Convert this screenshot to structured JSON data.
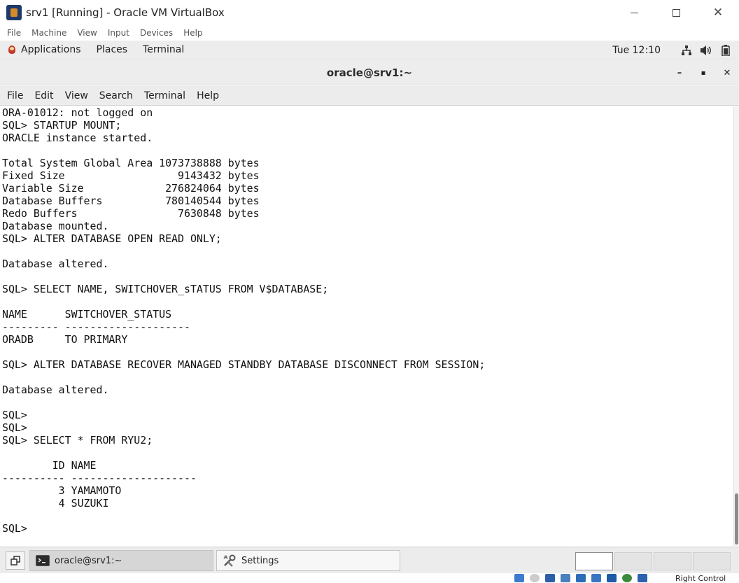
{
  "host": {
    "title": "srv1 [Running] - Oracle VM VirtualBox",
    "controls": {
      "minimize": "",
      "maximize": "",
      "close": "✕"
    }
  },
  "vbox_menu": [
    "File",
    "Machine",
    "View",
    "Input",
    "Devices",
    "Help"
  ],
  "guest_panel": {
    "items": [
      "Applications",
      "Places",
      "Terminal"
    ],
    "clock": "Tue 12:10"
  },
  "terminal": {
    "title": "oracle@srv1:~",
    "controls": {
      "minimize": "–",
      "maximize": "▪",
      "close": "✕"
    },
    "menu": [
      "File",
      "Edit",
      "View",
      "Search",
      "Terminal",
      "Help"
    ],
    "lines": [
      "ORA-01012: not logged on",
      "SQL> STARTUP MOUNT;",
      "ORACLE instance started.",
      "",
      "Total System Global Area 1073738888 bytes",
      "Fixed Size                  9143432 bytes",
      "Variable Size             276824064 bytes",
      "Database Buffers          780140544 bytes",
      "Redo Buffers                7630848 bytes",
      "Database mounted.",
      "SQL> ALTER DATABASE OPEN READ ONLY;",
      "",
      "Database altered.",
      "",
      "SQL> SELECT NAME, SWITCHOVER_sTATUS FROM V$DATABASE;",
      "",
      "NAME      SWITCHOVER_STATUS",
      "--------- --------------------",
      "ORADB     TO PRIMARY",
      "",
      "SQL> ALTER DATABASE RECOVER MANAGED STANDBY DATABASE DISCONNECT FROM SESSION;",
      "",
      "Database altered.",
      "",
      "SQL>",
      "SQL>",
      "SQL> SELECT * FROM RYU2;",
      "",
      "        ID NAME",
      "---------- --------------------",
      "         3 YAMAMOTO",
      "         4 SUZUKI",
      "",
      "SQL>"
    ]
  },
  "taskbar": {
    "tasks": [
      {
        "label": "oracle@srv1:~",
        "icon": "terminal-icon",
        "active": true
      },
      {
        "label": "Settings",
        "icon": "settings-tools-icon",
        "active": false
      }
    ],
    "workspaces": 4
  },
  "vbox_status": {
    "host_key": "Right Control"
  },
  "colors": {
    "panel_bg": "#ededed",
    "terminal_bg": "#ffffff",
    "terminal_fg": "#111111"
  }
}
